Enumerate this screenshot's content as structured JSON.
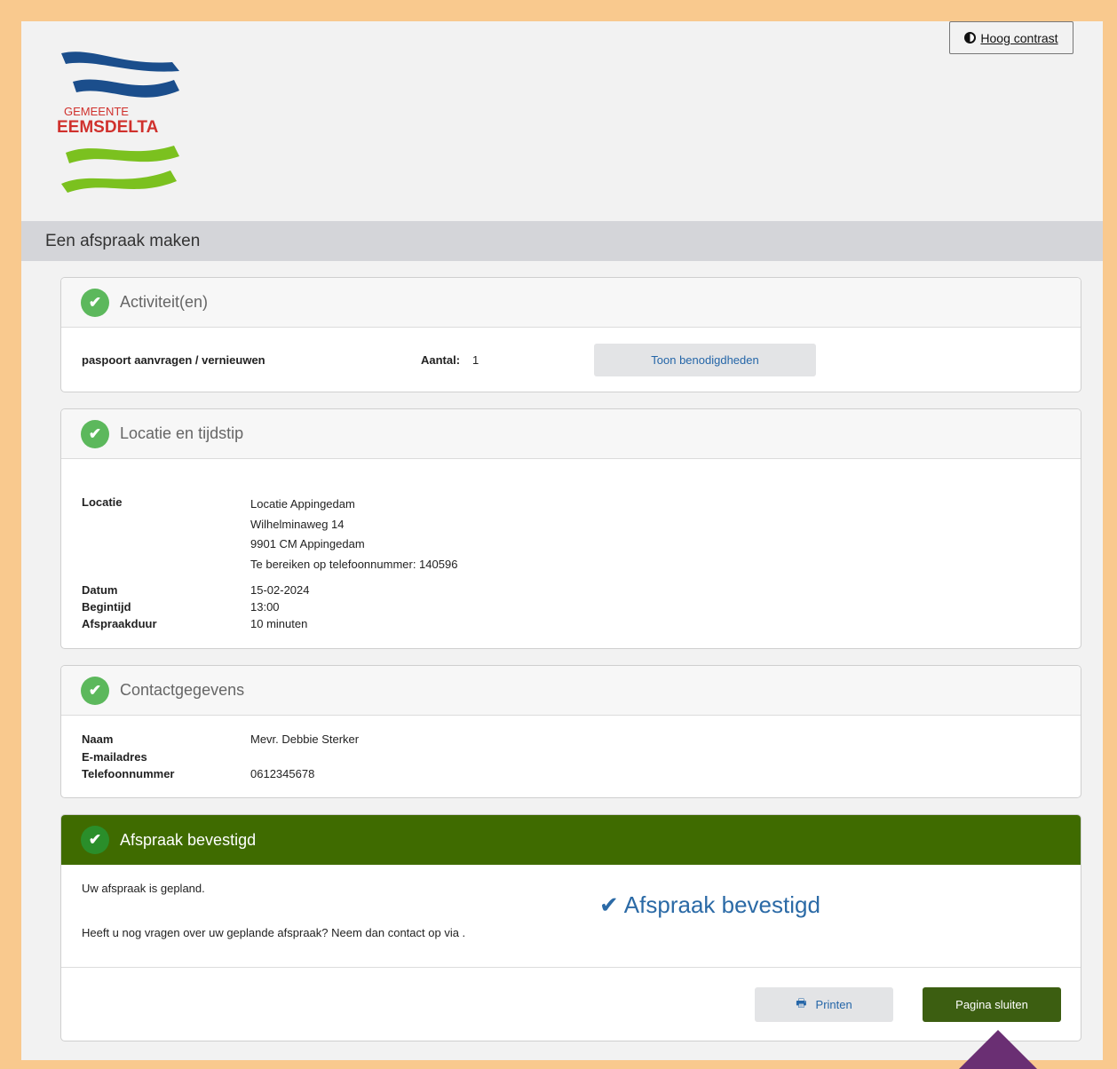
{
  "header": {
    "contrast_label": "Hoog contrast",
    "logo_line1": "GEMEENTE",
    "logo_line2": "EEMSDELTA",
    "band_title": "Een afspraak maken"
  },
  "colors": {
    "logo_blue": "#1b4e8c",
    "logo_red": "#d0312d",
    "logo_green": "#7bc11f",
    "confirmed_header": "#3f6b00",
    "check_green": "#5cb85c",
    "accent_link": "#2566a8",
    "outer_background": "#f9c98e"
  },
  "activities": {
    "title": "Activiteit(en)",
    "name": "paspoort aanvragen / vernieuwen",
    "count_label": "Aantal:",
    "count_value": "1",
    "button_label": "Toon benodigdheden"
  },
  "location": {
    "title": "Locatie en tijdstip",
    "location_label": "Locatie",
    "address": [
      "Locatie Appingedam",
      "Wilhelminaweg 14",
      "9901 CM Appingedam",
      "Te bereiken op telefoonnummer: 140596"
    ],
    "date_label": "Datum",
    "date_value": "15-02-2024",
    "start_label": "Begintijd",
    "start_value": "13:00",
    "duration_label": "Afspraakduur",
    "duration_value": "10 minuten"
  },
  "contact": {
    "title": "Contactgegevens",
    "name_label": "Naam",
    "name_value": "Mevr. Debbie Sterker",
    "email_label": "E-mailadres",
    "email_value": "",
    "phone_label": "Telefoonnummer",
    "phone_value": "0612345678"
  },
  "confirmation": {
    "title": "Afspraak bevestigd",
    "line1": "Uw afspraak is gepland.",
    "line2": "Heeft u nog vragen over uw geplande afspraak? Neem dan contact op via .",
    "big_label": "Afspraak bevestigd",
    "print_label": "Printen",
    "close_label": "Pagina sluiten"
  },
  "icons": {
    "contrast": "contrast-icon",
    "check": "check-circle-icon",
    "print": "printer-icon",
    "confirm": "checkmark-icon"
  }
}
